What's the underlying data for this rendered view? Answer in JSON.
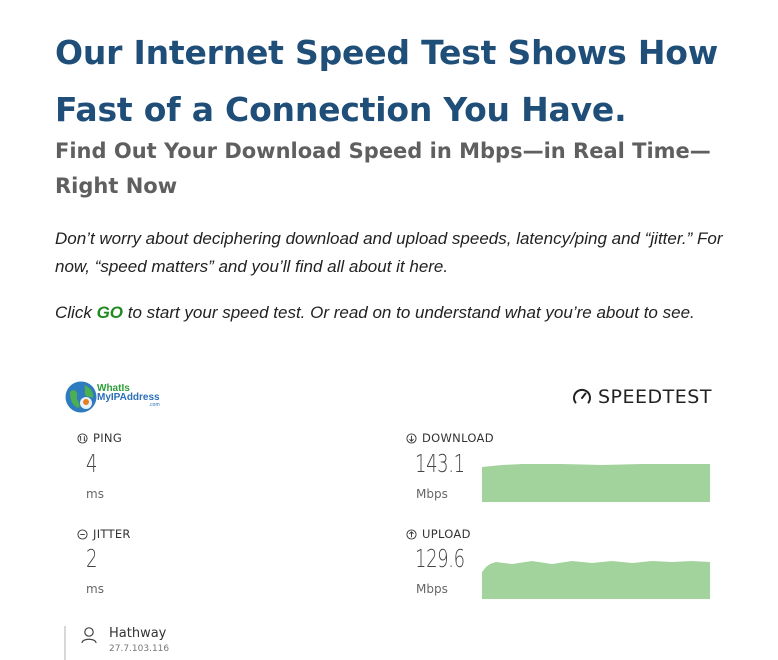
{
  "article": {
    "title": "Our Internet Speed Test Shows How Fast of a Connection You Have.",
    "subtitle": "Find Out Your Download Speed in Mbps—in Real Time—Right Now",
    "intro": "Don’t worry about deciphering download and upload speeds, latency/ping and “jitter.” For now, “speed matters” and you’ll find all about it here.",
    "cta_before": "Click ",
    "cta_go": "GO",
    "cta_after": " to start your speed test. Or read on to understand what you’re about to see."
  },
  "widget": {
    "logo_line1": "WhatIs",
    "logo_line2": "MyIPAddress",
    "logo_line3": ".com",
    "brand": "SPEEDTEST",
    "ping": {
      "label": "PING",
      "value": "4",
      "unit": "ms"
    },
    "jitter": {
      "label": "JITTER",
      "value": "2",
      "unit": "ms"
    },
    "download": {
      "label": "DOWNLOAD",
      "value": "143.1",
      "unit": "Mbps"
    },
    "upload": {
      "label": "UPLOAD",
      "value": "129.6",
      "unit": "Mbps"
    },
    "isp": {
      "name": "Hathway",
      "ip": "27.7.103.116"
    }
  },
  "colors": {
    "title": "#1f4e79",
    "go": "#1f8a1f",
    "graph_fill": "#a3d39c"
  }
}
